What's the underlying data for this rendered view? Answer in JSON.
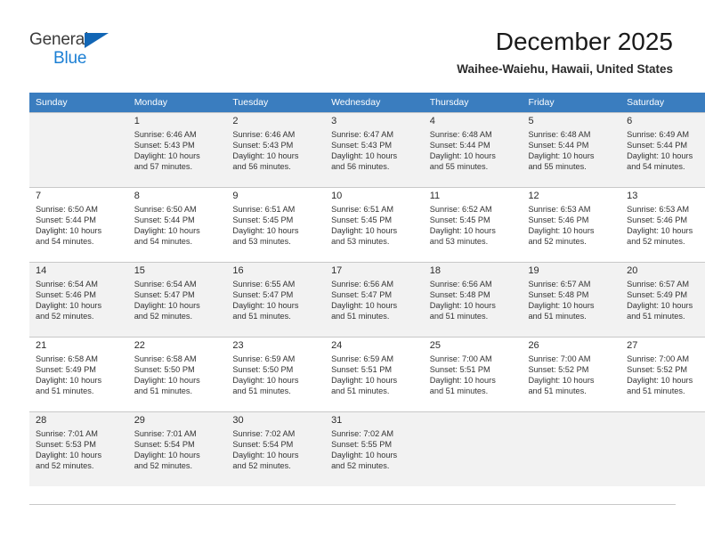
{
  "brand": {
    "name_part1": "General",
    "name_part2": "Blue",
    "triangle_color": "#1266b5",
    "blue_color": "#1b7fd4"
  },
  "header": {
    "title": "December 2025",
    "subtitle": "Waihee-Waiehu, Hawaii, United States"
  },
  "theme": {
    "header_row_bg": "#3a7dbf",
    "header_row_text": "#ffffff",
    "shaded_row_bg": "#f2f2f2",
    "grid_line": "#c8c8c8"
  },
  "weekdays": [
    "Sunday",
    "Monday",
    "Tuesday",
    "Wednesday",
    "Thursday",
    "Friday",
    "Saturday"
  ],
  "weeks": [
    {
      "shaded": true,
      "days": [
        {
          "num": "",
          "sunrise": "",
          "sunset": "",
          "daylight1": "",
          "daylight2": ""
        },
        {
          "num": "1",
          "sunrise": "Sunrise: 6:46 AM",
          "sunset": "Sunset: 5:43 PM",
          "daylight1": "Daylight: 10 hours",
          "daylight2": "and 57 minutes."
        },
        {
          "num": "2",
          "sunrise": "Sunrise: 6:46 AM",
          "sunset": "Sunset: 5:43 PM",
          "daylight1": "Daylight: 10 hours",
          "daylight2": "and 56 minutes."
        },
        {
          "num": "3",
          "sunrise": "Sunrise: 6:47 AM",
          "sunset": "Sunset: 5:43 PM",
          "daylight1": "Daylight: 10 hours",
          "daylight2": "and 56 minutes."
        },
        {
          "num": "4",
          "sunrise": "Sunrise: 6:48 AM",
          "sunset": "Sunset: 5:44 PM",
          "daylight1": "Daylight: 10 hours",
          "daylight2": "and 55 minutes."
        },
        {
          "num": "5",
          "sunrise": "Sunrise: 6:48 AM",
          "sunset": "Sunset: 5:44 PM",
          "daylight1": "Daylight: 10 hours",
          "daylight2": "and 55 minutes."
        },
        {
          "num": "6",
          "sunrise": "Sunrise: 6:49 AM",
          "sunset": "Sunset: 5:44 PM",
          "daylight1": "Daylight: 10 hours",
          "daylight2": "and 54 minutes."
        }
      ]
    },
    {
      "shaded": false,
      "days": [
        {
          "num": "7",
          "sunrise": "Sunrise: 6:50 AM",
          "sunset": "Sunset: 5:44 PM",
          "daylight1": "Daylight: 10 hours",
          "daylight2": "and 54 minutes."
        },
        {
          "num": "8",
          "sunrise": "Sunrise: 6:50 AM",
          "sunset": "Sunset: 5:44 PM",
          "daylight1": "Daylight: 10 hours",
          "daylight2": "and 54 minutes."
        },
        {
          "num": "9",
          "sunrise": "Sunrise: 6:51 AM",
          "sunset": "Sunset: 5:45 PM",
          "daylight1": "Daylight: 10 hours",
          "daylight2": "and 53 minutes."
        },
        {
          "num": "10",
          "sunrise": "Sunrise: 6:51 AM",
          "sunset": "Sunset: 5:45 PM",
          "daylight1": "Daylight: 10 hours",
          "daylight2": "and 53 minutes."
        },
        {
          "num": "11",
          "sunrise": "Sunrise: 6:52 AM",
          "sunset": "Sunset: 5:45 PM",
          "daylight1": "Daylight: 10 hours",
          "daylight2": "and 53 minutes."
        },
        {
          "num": "12",
          "sunrise": "Sunrise: 6:53 AM",
          "sunset": "Sunset: 5:46 PM",
          "daylight1": "Daylight: 10 hours",
          "daylight2": "and 52 minutes."
        },
        {
          "num": "13",
          "sunrise": "Sunrise: 6:53 AM",
          "sunset": "Sunset: 5:46 PM",
          "daylight1": "Daylight: 10 hours",
          "daylight2": "and 52 minutes."
        }
      ]
    },
    {
      "shaded": true,
      "days": [
        {
          "num": "14",
          "sunrise": "Sunrise: 6:54 AM",
          "sunset": "Sunset: 5:46 PM",
          "daylight1": "Daylight: 10 hours",
          "daylight2": "and 52 minutes."
        },
        {
          "num": "15",
          "sunrise": "Sunrise: 6:54 AM",
          "sunset": "Sunset: 5:47 PM",
          "daylight1": "Daylight: 10 hours",
          "daylight2": "and 52 minutes."
        },
        {
          "num": "16",
          "sunrise": "Sunrise: 6:55 AM",
          "sunset": "Sunset: 5:47 PM",
          "daylight1": "Daylight: 10 hours",
          "daylight2": "and 51 minutes."
        },
        {
          "num": "17",
          "sunrise": "Sunrise: 6:56 AM",
          "sunset": "Sunset: 5:47 PM",
          "daylight1": "Daylight: 10 hours",
          "daylight2": "and 51 minutes."
        },
        {
          "num": "18",
          "sunrise": "Sunrise: 6:56 AM",
          "sunset": "Sunset: 5:48 PM",
          "daylight1": "Daylight: 10 hours",
          "daylight2": "and 51 minutes."
        },
        {
          "num": "19",
          "sunrise": "Sunrise: 6:57 AM",
          "sunset": "Sunset: 5:48 PM",
          "daylight1": "Daylight: 10 hours",
          "daylight2": "and 51 minutes."
        },
        {
          "num": "20",
          "sunrise": "Sunrise: 6:57 AM",
          "sunset": "Sunset: 5:49 PM",
          "daylight1": "Daylight: 10 hours",
          "daylight2": "and 51 minutes."
        }
      ]
    },
    {
      "shaded": false,
      "days": [
        {
          "num": "21",
          "sunrise": "Sunrise: 6:58 AM",
          "sunset": "Sunset: 5:49 PM",
          "daylight1": "Daylight: 10 hours",
          "daylight2": "and 51 minutes."
        },
        {
          "num": "22",
          "sunrise": "Sunrise: 6:58 AM",
          "sunset": "Sunset: 5:50 PM",
          "daylight1": "Daylight: 10 hours",
          "daylight2": "and 51 minutes."
        },
        {
          "num": "23",
          "sunrise": "Sunrise: 6:59 AM",
          "sunset": "Sunset: 5:50 PM",
          "daylight1": "Daylight: 10 hours",
          "daylight2": "and 51 minutes."
        },
        {
          "num": "24",
          "sunrise": "Sunrise: 6:59 AM",
          "sunset": "Sunset: 5:51 PM",
          "daylight1": "Daylight: 10 hours",
          "daylight2": "and 51 minutes."
        },
        {
          "num": "25",
          "sunrise": "Sunrise: 7:00 AM",
          "sunset": "Sunset: 5:51 PM",
          "daylight1": "Daylight: 10 hours",
          "daylight2": "and 51 minutes."
        },
        {
          "num": "26",
          "sunrise": "Sunrise: 7:00 AM",
          "sunset": "Sunset: 5:52 PM",
          "daylight1": "Daylight: 10 hours",
          "daylight2": "and 51 minutes."
        },
        {
          "num": "27",
          "sunrise": "Sunrise: 7:00 AM",
          "sunset": "Sunset: 5:52 PM",
          "daylight1": "Daylight: 10 hours",
          "daylight2": "and 51 minutes."
        }
      ]
    },
    {
      "shaded": true,
      "days": [
        {
          "num": "28",
          "sunrise": "Sunrise: 7:01 AM",
          "sunset": "Sunset: 5:53 PM",
          "daylight1": "Daylight: 10 hours",
          "daylight2": "and 52 minutes."
        },
        {
          "num": "29",
          "sunrise": "Sunrise: 7:01 AM",
          "sunset": "Sunset: 5:54 PM",
          "daylight1": "Daylight: 10 hours",
          "daylight2": "and 52 minutes."
        },
        {
          "num": "30",
          "sunrise": "Sunrise: 7:02 AM",
          "sunset": "Sunset: 5:54 PM",
          "daylight1": "Daylight: 10 hours",
          "daylight2": "and 52 minutes."
        },
        {
          "num": "31",
          "sunrise": "Sunrise: 7:02 AM",
          "sunset": "Sunset: 5:55 PM",
          "daylight1": "Daylight: 10 hours",
          "daylight2": "and 52 minutes."
        },
        {
          "num": "",
          "sunrise": "",
          "sunset": "",
          "daylight1": "",
          "daylight2": ""
        },
        {
          "num": "",
          "sunrise": "",
          "sunset": "",
          "daylight1": "",
          "daylight2": ""
        },
        {
          "num": "",
          "sunrise": "",
          "sunset": "",
          "daylight1": "",
          "daylight2": ""
        }
      ]
    }
  ]
}
